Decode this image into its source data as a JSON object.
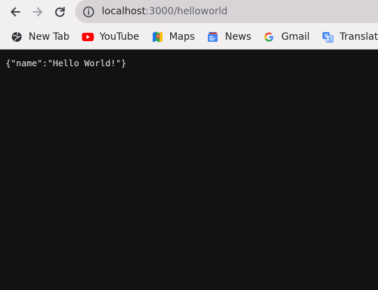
{
  "toolbar": {
    "back_icon": "arrow-left-icon",
    "forward_icon": "arrow-right-icon",
    "reload_icon": "reload-icon",
    "site_info_icon": "site-info-icon",
    "url_host": "localhost",
    "url_rest": ":3000/helloworld"
  },
  "bookmarks": [
    {
      "label": "New Tab",
      "icon": "new-tab-icon"
    },
    {
      "label": "YouTube",
      "icon": "youtube-icon"
    },
    {
      "label": "Maps",
      "icon": "maps-icon"
    },
    {
      "label": "News",
      "icon": "news-icon"
    },
    {
      "label": "Gmail",
      "icon": "gmail-icon"
    },
    {
      "label": "Translate",
      "icon": "translate-icon"
    }
  ],
  "page": {
    "json_text": "{\"name\":\"Hello World!\"}"
  },
  "colors": {
    "chrome_background": "#f1eff0",
    "address_bar_background": "#d8d3d6",
    "page_background": "#121212",
    "page_text": "#e8e8e8"
  }
}
